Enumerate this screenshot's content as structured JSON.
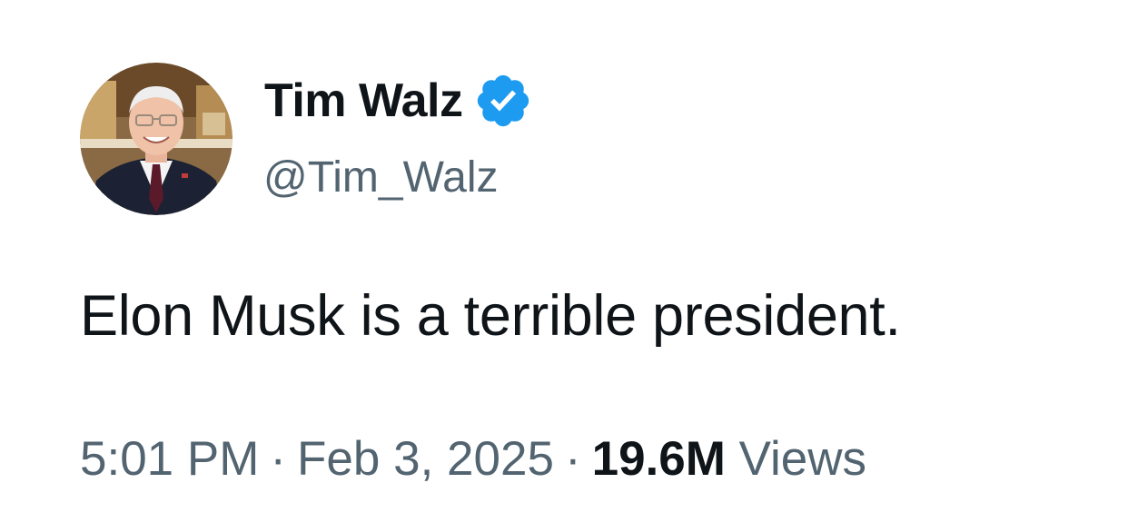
{
  "author": {
    "display_name": "Tim Walz",
    "handle": "@Tim_Walz",
    "verified": true,
    "verified_color": "#1d9bf0",
    "avatar_icon": "profile-photo"
  },
  "tweet": {
    "text": "Elon Musk is a terrible president."
  },
  "meta": {
    "time": "5:01 PM",
    "separator": "·",
    "date": "Feb 3, 2025",
    "views_count": "19.6M",
    "views_label": "Views"
  },
  "colors": {
    "primary_text": "#0f1419",
    "secondary_text": "#536471",
    "background": "#ffffff"
  }
}
